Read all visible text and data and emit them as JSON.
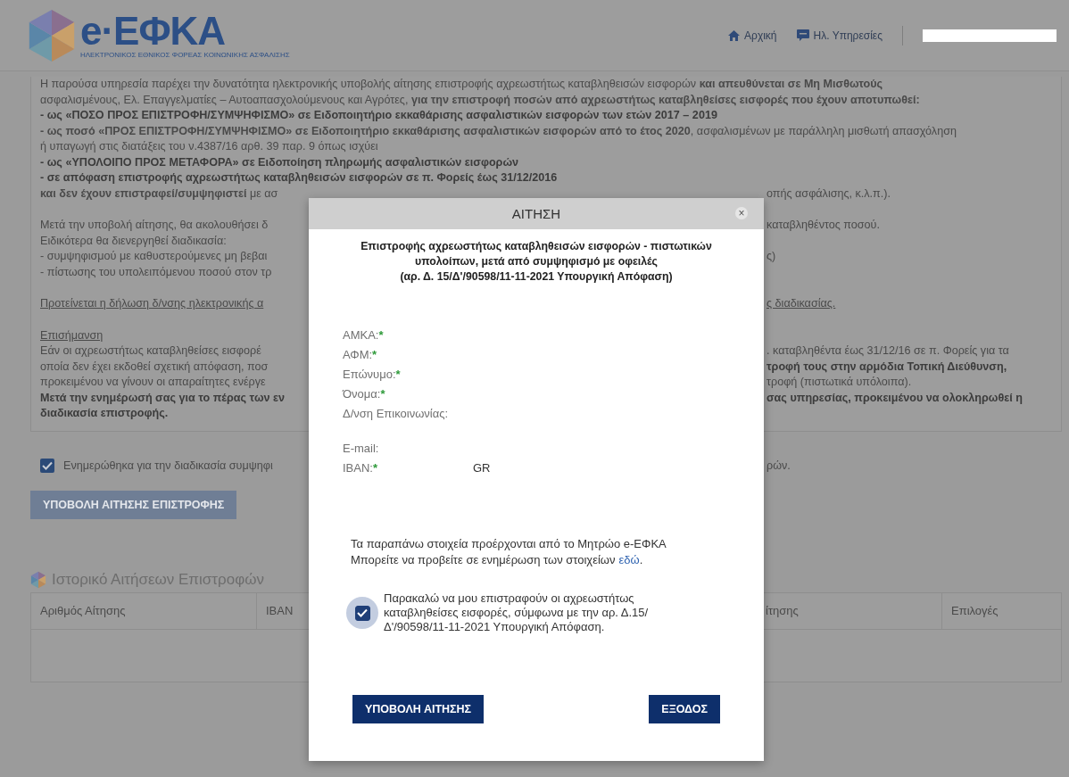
{
  "header": {
    "logo": {
      "text": "e·ΕΦΚΑ",
      "tagline": "ΗΛΕΚΤΡΟΝΙΚΟΣ ΕΘΝΙΚΟΣ ΦΟΡΕΑΣ ΚΟΙΝΩΝΙΚΗΣ ΑΣΦΑΛΙΣΗΣ"
    },
    "nav": [
      {
        "label": "Αρχική",
        "kind": "home"
      },
      {
        "label": "Ηλ. Υπηρεσίες",
        "kind": "services"
      }
    ]
  },
  "intro_lines": [
    {
      "text": "Η παρούσα υπηρεσία παρέχει την δυνατότητα ηλεκτρονικής υποβολής αίτησης επιστροφής αχρεωστήτως καταβληθεισών εισφορών **και απευθύνεται σε Μη Μισθωτούς**",
      "bold": false
    },
    {
      "text": "ασφαλισμένους, Ελ. Επαγγελματίες – Αυτοαπασχολούμενους και Αγρότες, **για την επιστροφή ποσών από αχρεωστήτως καταβληθείσες εισφορές που έχουν αποτυπωθεί:**",
      "bold": false
    },
    {
      "text": "- ως «ΠΟΣΟ ΠΡΟΣ ΕΠΙΣΤΡΟΦΗ/ΣΥΜΨΗΦΙΣΜΟ» σε Ειδοποιητήριο εκκαθάρισης ασφαλιστικών εισφορών των ετών 2017 – 2019",
      "bold": true
    },
    {
      "text": "**- ως ποσό «ΠΡΟΣ ΕΠΙΣΤΡΟΦΗ/ΣΥΜΨΗΦΙΣΜΟ» σε Ειδοποιητήριο εκκαθάρισης ασφαλιστικών εισφορών από το έτος 2020**, ασφαλισμένων με παράλληλη μισθωτή απασχόληση",
      "bold": false
    },
    {
      "text": "ή υπαγωγή στις διατάξεις του ν.4387/16 αρθ. 39 παρ. 9 όπως ισχύει",
      "bold": false
    },
    {
      "text": "- ως «ΥΠΟΛΟΙΠΟ ΠΡΟΣ ΜΕΤΑΦΟΡΑ» σε Ειδοποίηση πληρωμής ασφαλιστικών εισφορών",
      "bold": true
    },
    {
      "text": "- σε απόφαση επιστροφής αχρεωστήτως καταβληθεισών εισφορών σε π. Φορείς έως 31/12/2016",
      "bold": true
    }
  ],
  "split_rows": [
    {
      "kind": "text",
      "left": "**και δεν έχουν επιστραφεί/συμψηφιστεί** με ασ",
      "right": "οπής ασφάλισης, κ.λ.π.).",
      "left_bold": false,
      "right_bold": false
    },
    {
      "kind": "spacer"
    },
    {
      "kind": "text",
      "left": "Μετά την υποβολή αίτησης, θα ακολουθήσει δ",
      "right": "καταβληθέντος ποσού.",
      "left_bold": false,
      "right_bold": false
    },
    {
      "kind": "text",
      "left": "Ειδικότερα θα διενεργηθεί διαδικασία:",
      "left_bold": false
    },
    {
      "kind": "text",
      "left": "- συμψηφισμού με καθυστερούμενες μη βεβαι",
      "right": "ς)",
      "left_bold": false,
      "right_bold": false
    },
    {
      "kind": "text",
      "left": "- πίστωσης του υπολειπόμενου ποσού στον τρ",
      "left_bold": false
    },
    {
      "kind": "spacer"
    },
    {
      "kind": "link",
      "left": "Προτείνεται η δήλωση δ/νσης ηλεκτρονικής α",
      "right": "ς διαδικασίας."
    },
    {
      "kind": "spacer"
    },
    {
      "kind": "heading",
      "left": "Επισήμανση"
    },
    {
      "kind": "text",
      "left": "Εάν οι αχρεωστήτως καταβληθείσες εισφορέ",
      "right": ". καταβληθέντα έως 31/12/16 σε π. Φορείς για τα",
      "left_bold": false,
      "right_bold": false
    },
    {
      "kind": "text",
      "left": "οποία δεν έχει εκδοθεί σχετική απόφαση, ποσ",
      "right": "τροφή τους στην αρμόδια Τοπική Διεύθυνση,",
      "left_bold": false,
      "right_bold": true
    },
    {
      "kind": "text",
      "left": "προκειμένου να γίνουν οι απαραίτητες ενέργε",
      "right": "τροφή (πιστωτικά υπόλοιπα).",
      "left_bold": false,
      "right_bold": false
    },
    {
      "kind": "text",
      "left": "Μετά την ενημέρωσή σας για το πέρας των εν",
      "right": "σας υπηρεσίας, προκειμένου να ολοκληρωθεί η",
      "left_bold": true,
      "right_bold": true
    },
    {
      "kind": "text",
      "left": "διαδικασία επιστροφής.",
      "left_bold": true
    }
  ],
  "acknowledge": {
    "left": "Ενημερώθηκα για την διαδικασία συμψηφι",
    "right": "ρών.",
    "checked": true
  },
  "submit_button": "ΥΠΟΒΟΛΗ ΑΙΤΗΣΗΣ ΕΠΙΣΤΡΟΦΗΣ",
  "history": {
    "title": "Ιστορικό Αιτήσεων Επιστροφών",
    "columns": [
      "Αριθμός Αίτησης",
      "IBAN",
      "ίτησης",
      "Επιλογές"
    ]
  },
  "modal": {
    "title": "ΑΙΤΗΣΗ",
    "close": "×",
    "subtitle": [
      "Επιστροφής αχρεωστήτως καταβληθεισών εισφορών - πιστωτικών",
      "υπολοίπων, μετά από συμψηφισμό με οφειλές",
      "(αρ. Δ. 15/Δ'/90598/11-11-2021 Υπουργική Απόφαση)"
    ],
    "fields": [
      {
        "label": "ΑΜΚΑ:",
        "required_mark": "*"
      },
      {
        "label": "ΑΦΜ:",
        "required_mark": "*"
      },
      {
        "label": "Επώνυμο:",
        "required_mark": "*"
      },
      {
        "label": "Όνομα:",
        "required_mark": "*"
      },
      {
        "label": "Δ/νση Επικοινωνίας:"
      },
      {
        "kind": "gap"
      },
      {
        "label": "E-mail:"
      },
      {
        "label": "IBAN:",
        "required_mark": "*",
        "value": "GR"
      }
    ],
    "info_end": ".",
    "info": [
      "Τα παραπάνω στοιχεία προέρχονται από το Μητρώο e-ΕΦΚΑ",
      "Μπορείτε να προβείτε σε ενημέρωση των στοιχείων"
    ],
    "info_link": "εδώ",
    "consent": {
      "text": "Παρακαλώ να μου επιστραφούν οι αχρεωστήτως καταβληθείσες εισφορές, σύμφωνα με την αρ. Δ.15/ Δ'/90598/11-11-2021 Υπουργική Απόφαση.",
      "checked": true
    },
    "buttons": [
      "ΥΠΟΒΟΛΗ ΑΙΤΗΣΗΣ",
      "ΕΞΟΔΟΣ"
    ]
  }
}
